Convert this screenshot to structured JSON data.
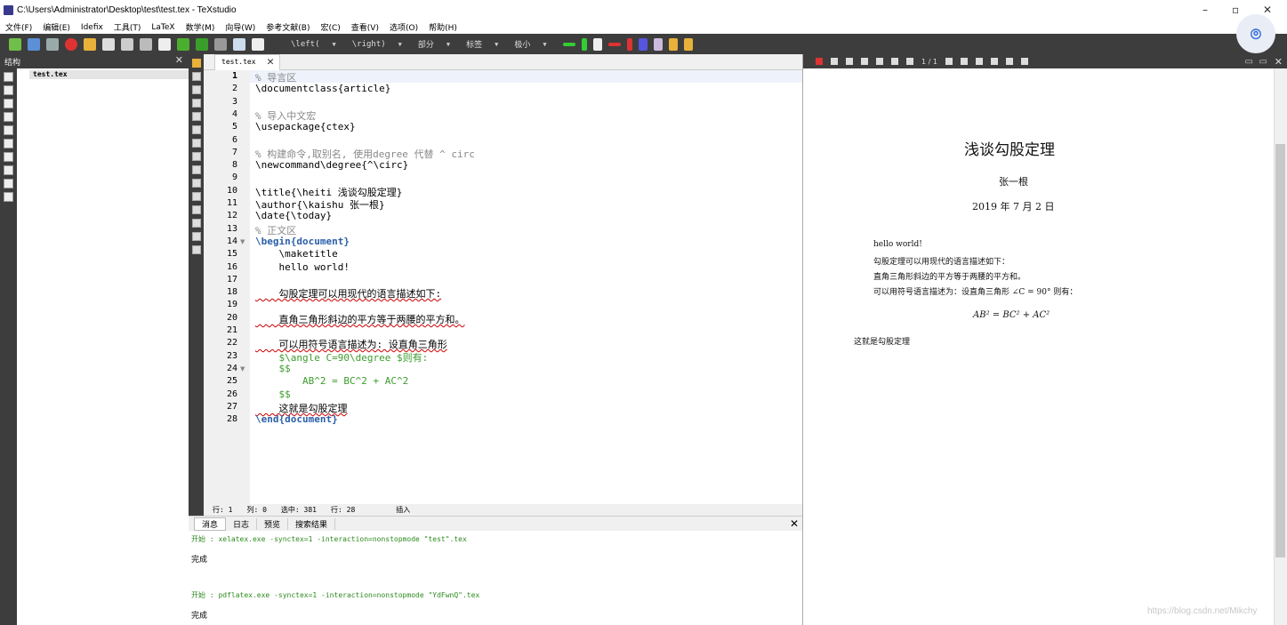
{
  "window": {
    "title": "C:\\Users\\Administrator\\Desktop\\test\\test.tex - TeXstudio",
    "min": "–",
    "max": "▫",
    "close": "✕"
  },
  "menu": [
    "文件(F)",
    "编辑(E)",
    "Idefix",
    "工具(T)",
    "LaTeX",
    "数学(M)",
    "向导(W)",
    "参考文献(B)",
    "宏(C)",
    "查看(V)",
    "选项(O)",
    "帮助(H)"
  ],
  "toolbar": {
    "left_sel": "\\left(",
    "right_sel": "\\right)",
    "section_sel": "部分",
    "label_sel": "标签",
    "size_sel": "极小"
  },
  "structure": {
    "title": "结构",
    "item": "test.tex"
  },
  "editor": {
    "tab": "test.tex",
    "lines": [
      {
        "n": "1",
        "text": "% 导言区"
      },
      {
        "n": "2",
        "text": "\\documentclass{article}"
      },
      {
        "n": "3",
        "text": ""
      },
      {
        "n": "4",
        "text": "% 导入中文宏"
      },
      {
        "n": "5",
        "text": "\\usepackage{ctex}"
      },
      {
        "n": "6",
        "text": ""
      },
      {
        "n": "7",
        "text": "% 构建命令,取别名, 使用degree 代替 ^ circ"
      },
      {
        "n": "8",
        "text": "\\newcommand\\degree{^\\circ}"
      },
      {
        "n": "9",
        "text": ""
      },
      {
        "n": "10",
        "text": "\\title{\\heiti 浅谈勾股定理}"
      },
      {
        "n": "11",
        "text": "\\author{\\kaishu 张一根}"
      },
      {
        "n": "12",
        "text": "\\date{\\today}"
      },
      {
        "n": "13",
        "text": "% 正文区"
      },
      {
        "n": "14",
        "text": "\\begin{document}"
      },
      {
        "n": "15",
        "text": "    \\maketitle"
      },
      {
        "n": "16",
        "text": "    hello world!"
      },
      {
        "n": "17",
        "text": ""
      },
      {
        "n": "18",
        "text": "    勾股定理可以用现代的语言描述如下:"
      },
      {
        "n": "19",
        "text": ""
      },
      {
        "n": "20",
        "text": "    直角三角形斜边的平方等于两腰的平方和。"
      },
      {
        "n": "21",
        "text": ""
      },
      {
        "n": "22",
        "text": "    可以用符号语言描述为: 设直角三角形"
      },
      {
        "n": "23",
        "text": "    $\\angle C=90\\degree $则有:"
      },
      {
        "n": "24",
        "text": "    $$"
      },
      {
        "n": "25",
        "text": "        AB^2 = BC^2 + AC^2"
      },
      {
        "n": "26",
        "text": "    $$"
      },
      {
        "n": "27",
        "text": "    这就是勾股定理"
      },
      {
        "n": "28",
        "text": "\\end{document}"
      }
    ],
    "status": {
      "row": "行: 1",
      "col": "列: 0",
      "sel": "选中: 381",
      "lines": "行: 28",
      "mode": "插入"
    }
  },
  "messages": {
    "tabs": [
      "消息",
      "日志",
      "预览",
      "搜索结果"
    ],
    "lines": [
      {
        "prefix": "开始 : ",
        "cmd": "xelatex.exe -synctex=1 -interaction=nonstopmode \"test\".tex"
      },
      {
        "prefix": "开始 : ",
        "cmd": "pdflatex.exe -synctex=1 -interaction=nonstopmode \"YdFwnQ\".tex"
      }
    ],
    "done": "完成"
  },
  "pdf": {
    "page_label": "1 / 1",
    "title": "浅谈勾股定理",
    "author": "张一根",
    "date": "2019 年 7 月 2 日",
    "body": [
      "hello world!",
      "勾股定理可以用现代的语言描述如下：",
      "直角三角形斜边的平方等于两腰的平方和。",
      "可以用符号语言描述为：设直角三角形 ∠C = 90° 则有："
    ],
    "equation": "AB² = BC² + AC²",
    "closing": "这就是勾股定理"
  },
  "watermark": "https://blog.csdn.net/Mikchy"
}
